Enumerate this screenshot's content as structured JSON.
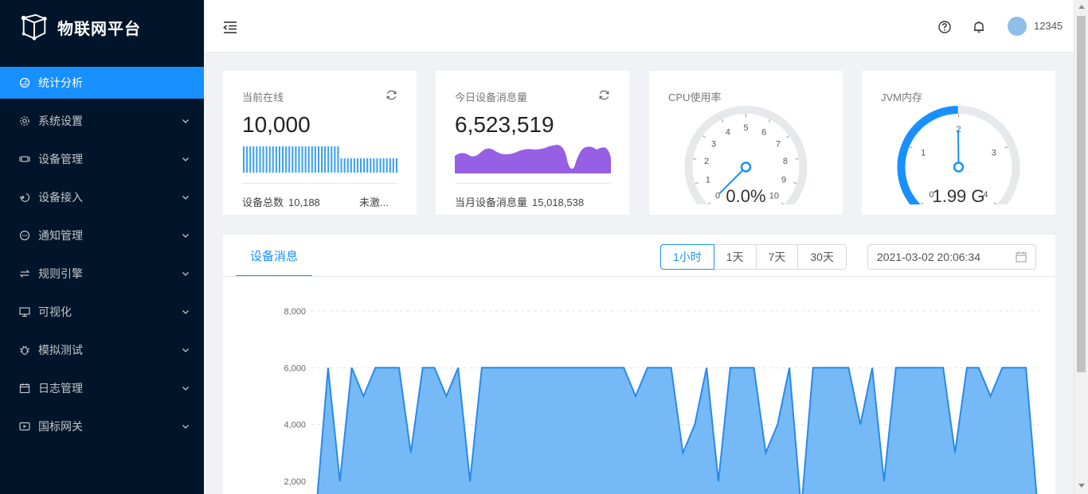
{
  "sidebar": {
    "logo_text": "物联网平台",
    "items": [
      {
        "label": "统计分析",
        "icon": "dashboard-icon",
        "active": true
      },
      {
        "label": "系统设置",
        "icon": "gear-icon"
      },
      {
        "label": "设备管理",
        "icon": "device-icon"
      },
      {
        "label": "设备接入",
        "icon": "access-icon"
      },
      {
        "label": "通知管理",
        "icon": "message-icon"
      },
      {
        "label": "规则引擎",
        "icon": "swap-icon"
      },
      {
        "label": "可视化",
        "icon": "monitor-icon"
      },
      {
        "label": "模拟测试",
        "icon": "bug-icon"
      },
      {
        "label": "日志管理",
        "icon": "calendar-icon"
      },
      {
        "label": "国标网关",
        "icon": "video-icon"
      }
    ]
  },
  "header": {
    "username": "12345"
  },
  "cards": {
    "online": {
      "title": "当前在线",
      "value": "10,000",
      "footer_label": "设备总数",
      "footer_value": "10,188",
      "footer2_label": "未激..."
    },
    "messages": {
      "title": "今日设备消息量",
      "value": "6,523,519",
      "footer_label": "当月设备消息量",
      "footer_value": "15,018,538"
    },
    "cpu": {
      "title": "CPU使用率",
      "value": "0.0%",
      "gauge_value": 0.0,
      "gauge_ticks": [
        "0",
        "1",
        "2",
        "3",
        "4",
        "5",
        "6",
        "7",
        "8",
        "9",
        "10"
      ]
    },
    "jvm": {
      "title": "JVM内存",
      "value": "1.99 G",
      "gauge_value": 1.99,
      "gauge_ticks": [
        "0",
        "1",
        "2",
        "3",
        "4"
      ]
    }
  },
  "panel": {
    "tab_label": "设备消息",
    "ranges": [
      "1小时",
      "1天",
      "7天",
      "30天"
    ],
    "active_range": "1小时",
    "date_value": "2021-03-02 20:06:34"
  },
  "colors": {
    "accent": "#1890ff",
    "sidebar_bg": "#001529",
    "area_fill": "#75b9f7",
    "area_line": "#2a8ae6",
    "mini_purple": "#975fe4"
  },
  "chart_data": {
    "type": "area",
    "y_ticks": [
      "8,000",
      "6,000",
      "4,000",
      "2,000"
    ],
    "ylim": [
      1000,
      9000
    ],
    "grid": true,
    "values": [
      1000,
      6000,
      2000,
      6000,
      5000,
      6000,
      6000,
      6000,
      3000,
      6000,
      6000,
      5000,
      6000,
      2000,
      6000,
      6000,
      6000,
      6000,
      6000,
      6000,
      6000,
      6000,
      6000,
      6000,
      6000,
      6000,
      6000,
      5000,
      6000,
      6000,
      6000,
      3000,
      4000,
      6000,
      2000,
      6000,
      6000,
      6000,
      3000,
      4000,
      6000,
      1000,
      6000,
      6000,
      6000,
      6000,
      4000,
      6000,
      2000,
      6000,
      6000,
      6000,
      6000,
      6000,
      3000,
      6000,
      6000,
      5000,
      6000,
      6000,
      6000,
      1000
    ]
  }
}
